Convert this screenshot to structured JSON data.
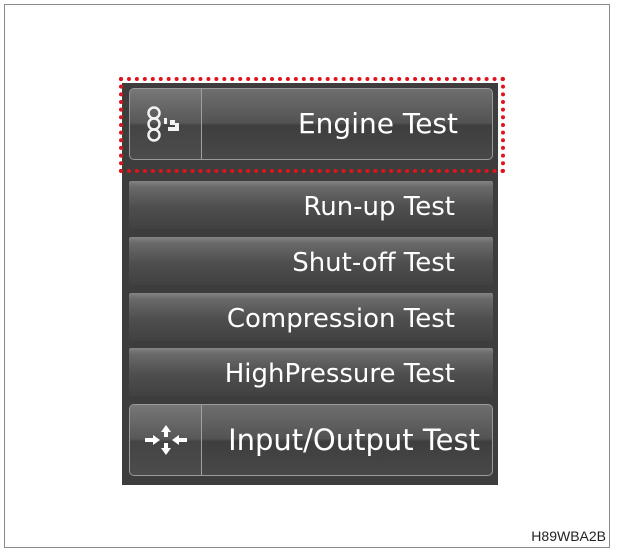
{
  "menu": {
    "engine_test": {
      "label": "Engine Test",
      "icon": "engine-icon"
    },
    "items": [
      {
        "label": "Run-up Test"
      },
      {
        "label": "Shut-off Test"
      },
      {
        "label": "Compression Test"
      },
      {
        "label": "HighPressure Test"
      }
    ],
    "io_test": {
      "label": "Input/Output Test",
      "icon": "arrows-io-icon"
    }
  },
  "highlight_color": "#e0141c",
  "figure_code": "H89WBA2B"
}
